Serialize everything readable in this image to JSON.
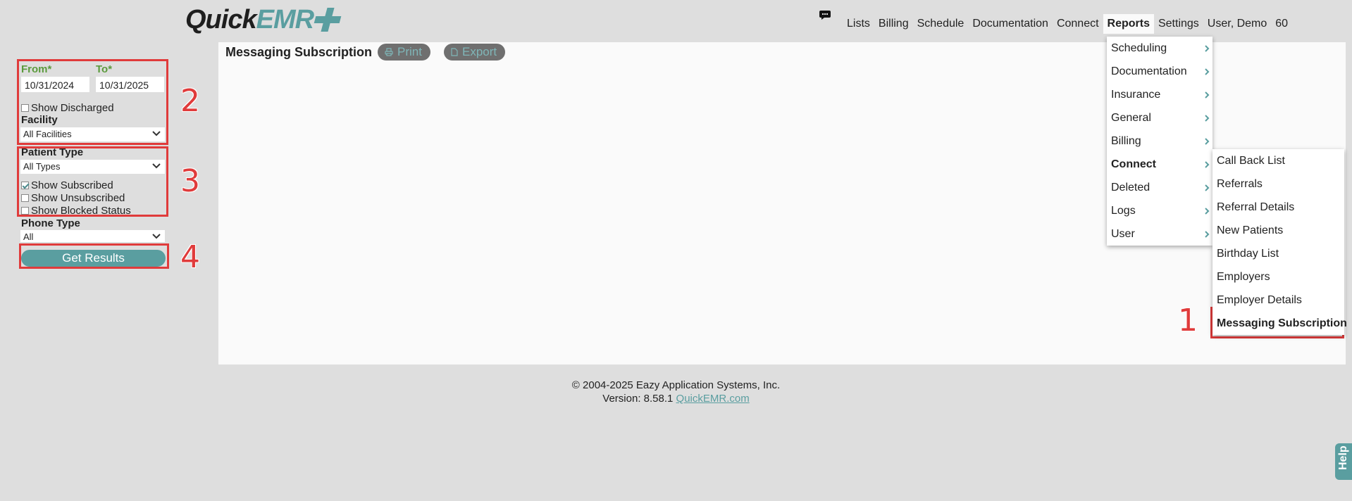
{
  "app": {
    "logo_quick": "Quick",
    "logo_emr": "EMR"
  },
  "topnav": {
    "items": [
      "Lists",
      "Billing",
      "Schedule",
      "Documentation",
      "Connect",
      "Reports",
      "Settings",
      "User, Demo",
      "60"
    ],
    "active": "Reports"
  },
  "page": {
    "title": "Messaging Subscription",
    "print_label": "Print",
    "export_label": "Export"
  },
  "filters": {
    "from_label": "From*",
    "to_label": "To*",
    "from_value": "10/31/2024",
    "to_value": "10/31/2025",
    "show_discharged_label": "Show Discharged",
    "show_discharged_checked": false,
    "facility_label": "Facility",
    "facility_value": "All Facilities",
    "patient_type_label": "Patient Type",
    "patient_type_value": "All Types",
    "show_subscribed_label": "Show Subscribed",
    "show_subscribed_checked": true,
    "show_unsubscribed_label": "Show Unsubscribed",
    "show_unsubscribed_checked": false,
    "show_blocked_label": "Show Blocked Status",
    "show_blocked_checked": false,
    "phone_type_label": "Phone Type",
    "phone_type_value": "All",
    "get_results_label": "Get Results"
  },
  "annotations": [
    "1",
    "2",
    "3",
    "4"
  ],
  "reports_menu": {
    "items": [
      "Scheduling",
      "Documentation",
      "Insurance",
      "General",
      "Billing",
      "Connect",
      "Deleted",
      "Logs",
      "User"
    ],
    "active": "Connect"
  },
  "connect_menu": {
    "items": [
      "Call Back List",
      "Referrals",
      "Referral Details",
      "New Patients",
      "Birthday List",
      "Employers",
      "Employer Details",
      "Messaging Subscription"
    ],
    "active": "Messaging Subscription"
  },
  "footer": {
    "copyright": "© 2004-2025 Eazy Application Systems, Inc.",
    "version": "Version: 8.58.1",
    "link": "QuickEMR.com"
  },
  "help_label": "Help",
  "colors": {
    "accent": "#5a9ea0",
    "annotation_red": "#e03b3b",
    "label_green": "#5b9a3c"
  }
}
